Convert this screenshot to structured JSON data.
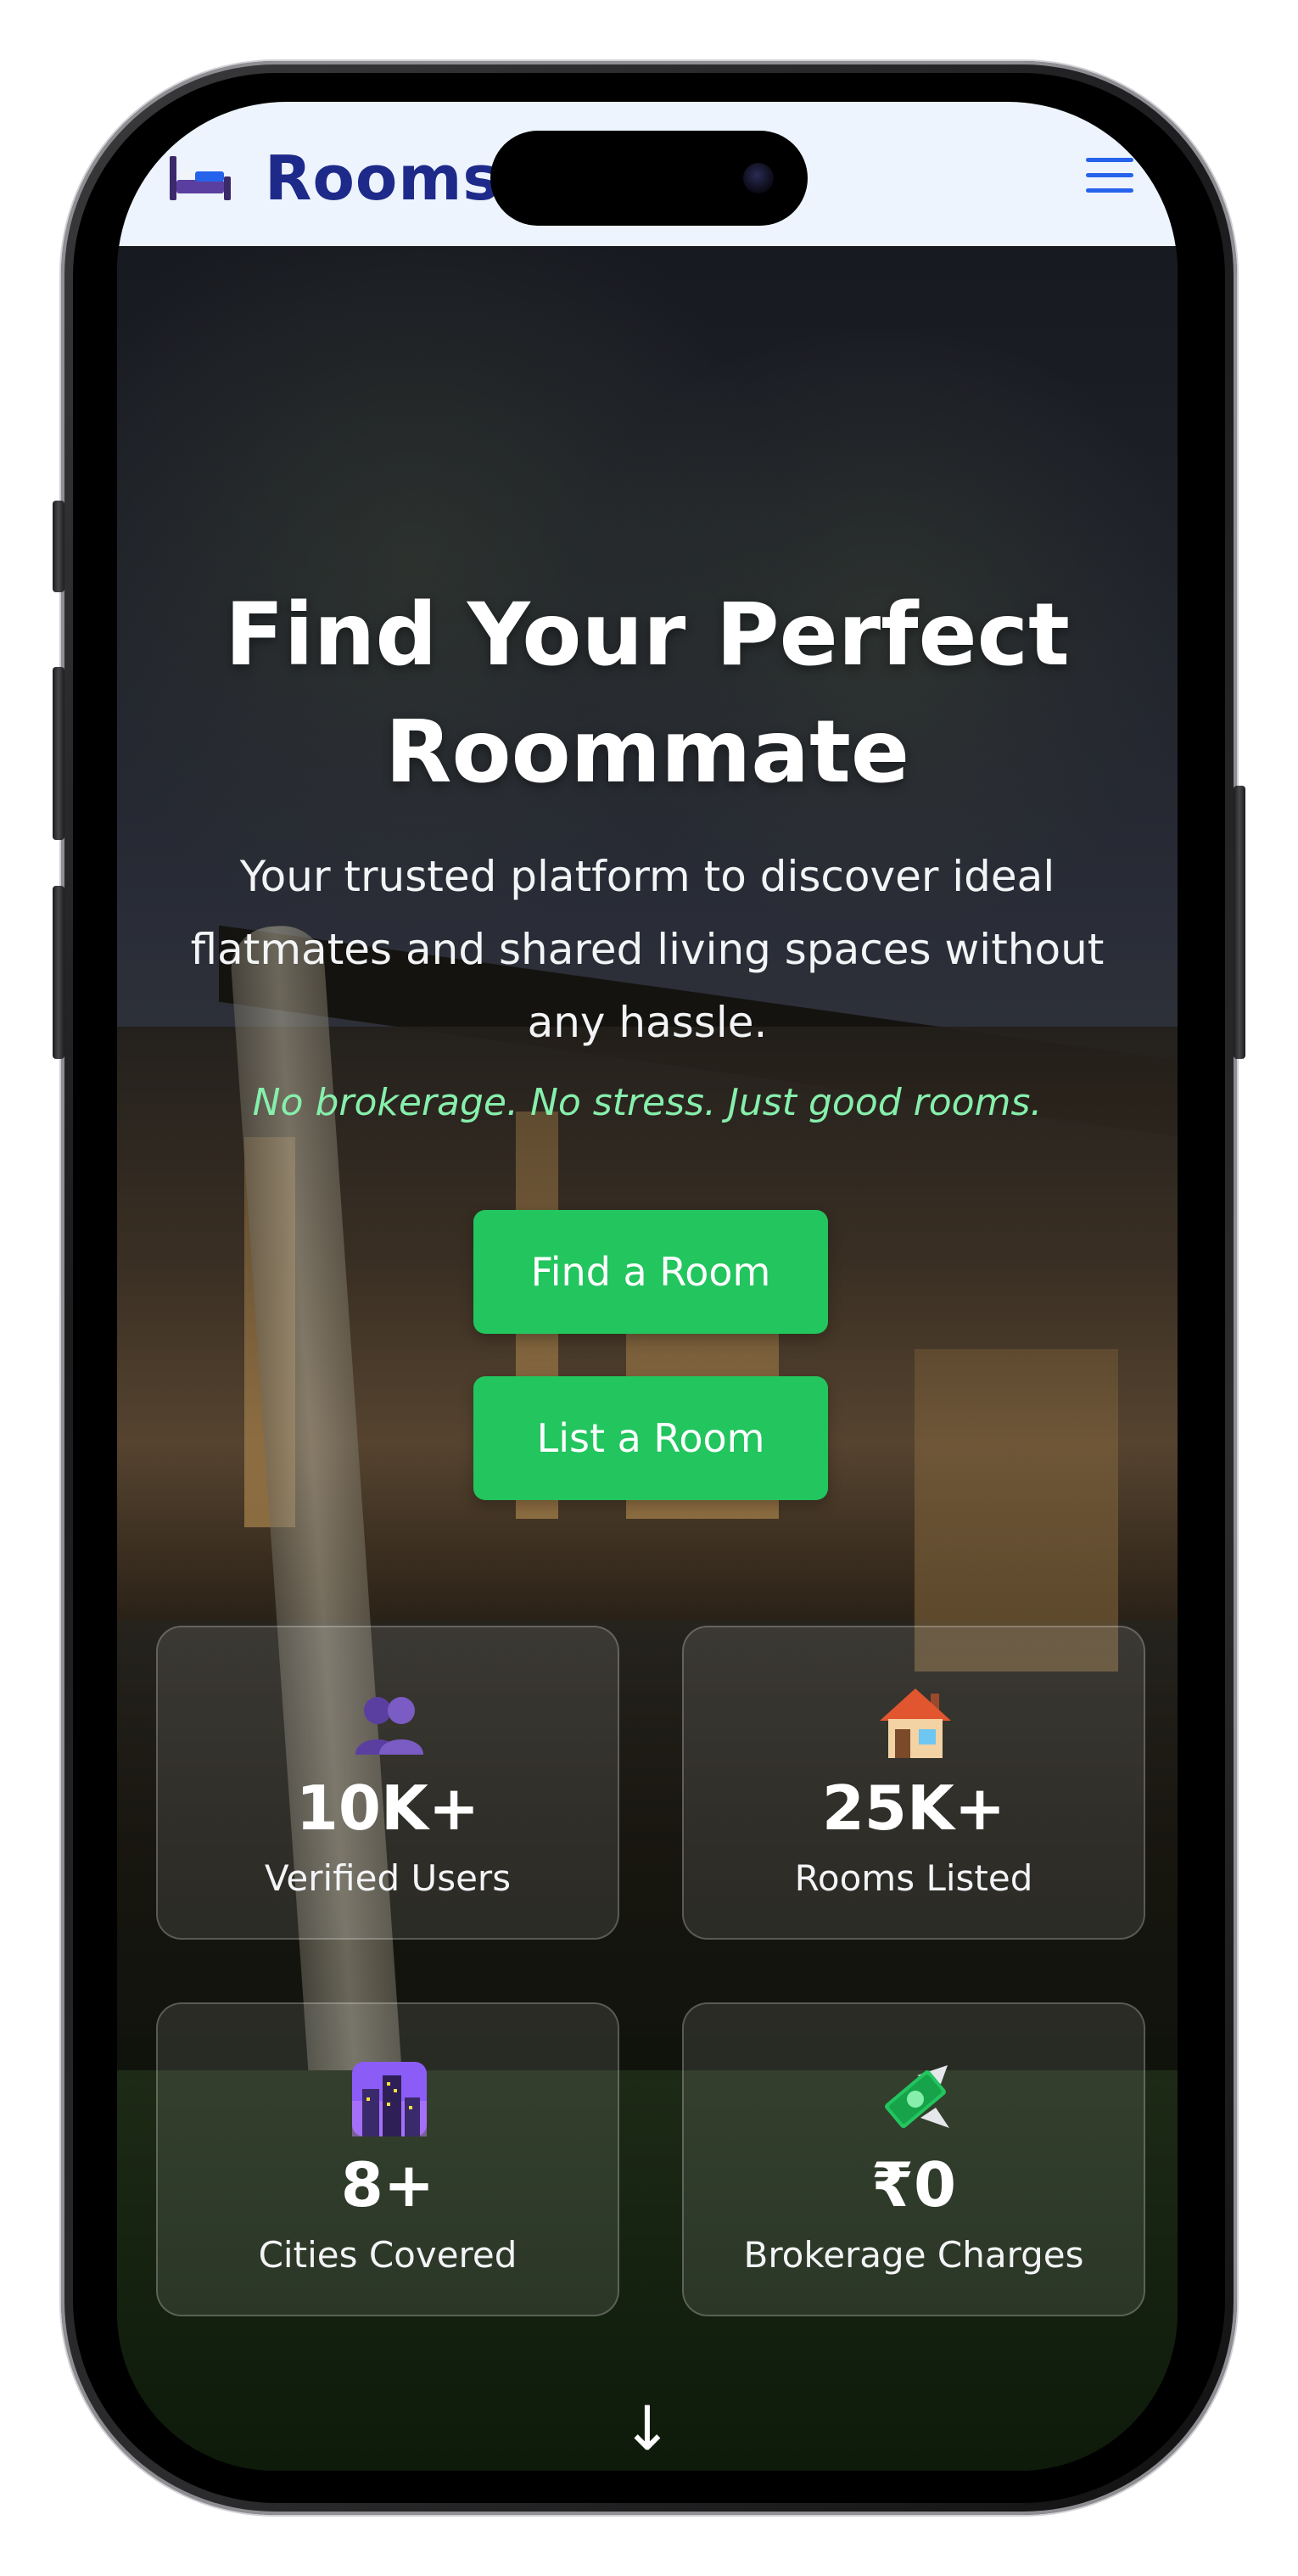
{
  "header": {
    "brand_name": "Roomsl",
    "logo_icon": "bed-icon",
    "menu_icon": "hamburger-menu-icon",
    "brand_color": "#1e2a8a",
    "menu_color": "#2563eb"
  },
  "hero": {
    "title": "Find Your Perfect Roommate",
    "subtitle": "Your trusted platform to discover ideal flatmates and shared living spaces without any hassle.",
    "tagline": "No brokerage. No stress. Just good rooms.",
    "tagline_color": "#86efac",
    "buttons": {
      "find_room": "Find a Room",
      "list_room": "List a Room"
    },
    "button_color": "#22c55e"
  },
  "stats": [
    {
      "icon": "users-icon",
      "value": "10K+",
      "label": "Verified Users"
    },
    {
      "icon": "house-icon",
      "value": "25K+",
      "label": "Rooms Listed"
    },
    {
      "icon": "cityscape-icon",
      "value": "8+",
      "label": "Cities Covered"
    },
    {
      "icon": "money-with-wings-icon",
      "value": "₹0",
      "label": "Brokerage Charges"
    }
  ],
  "scroll_indicator": "↓"
}
